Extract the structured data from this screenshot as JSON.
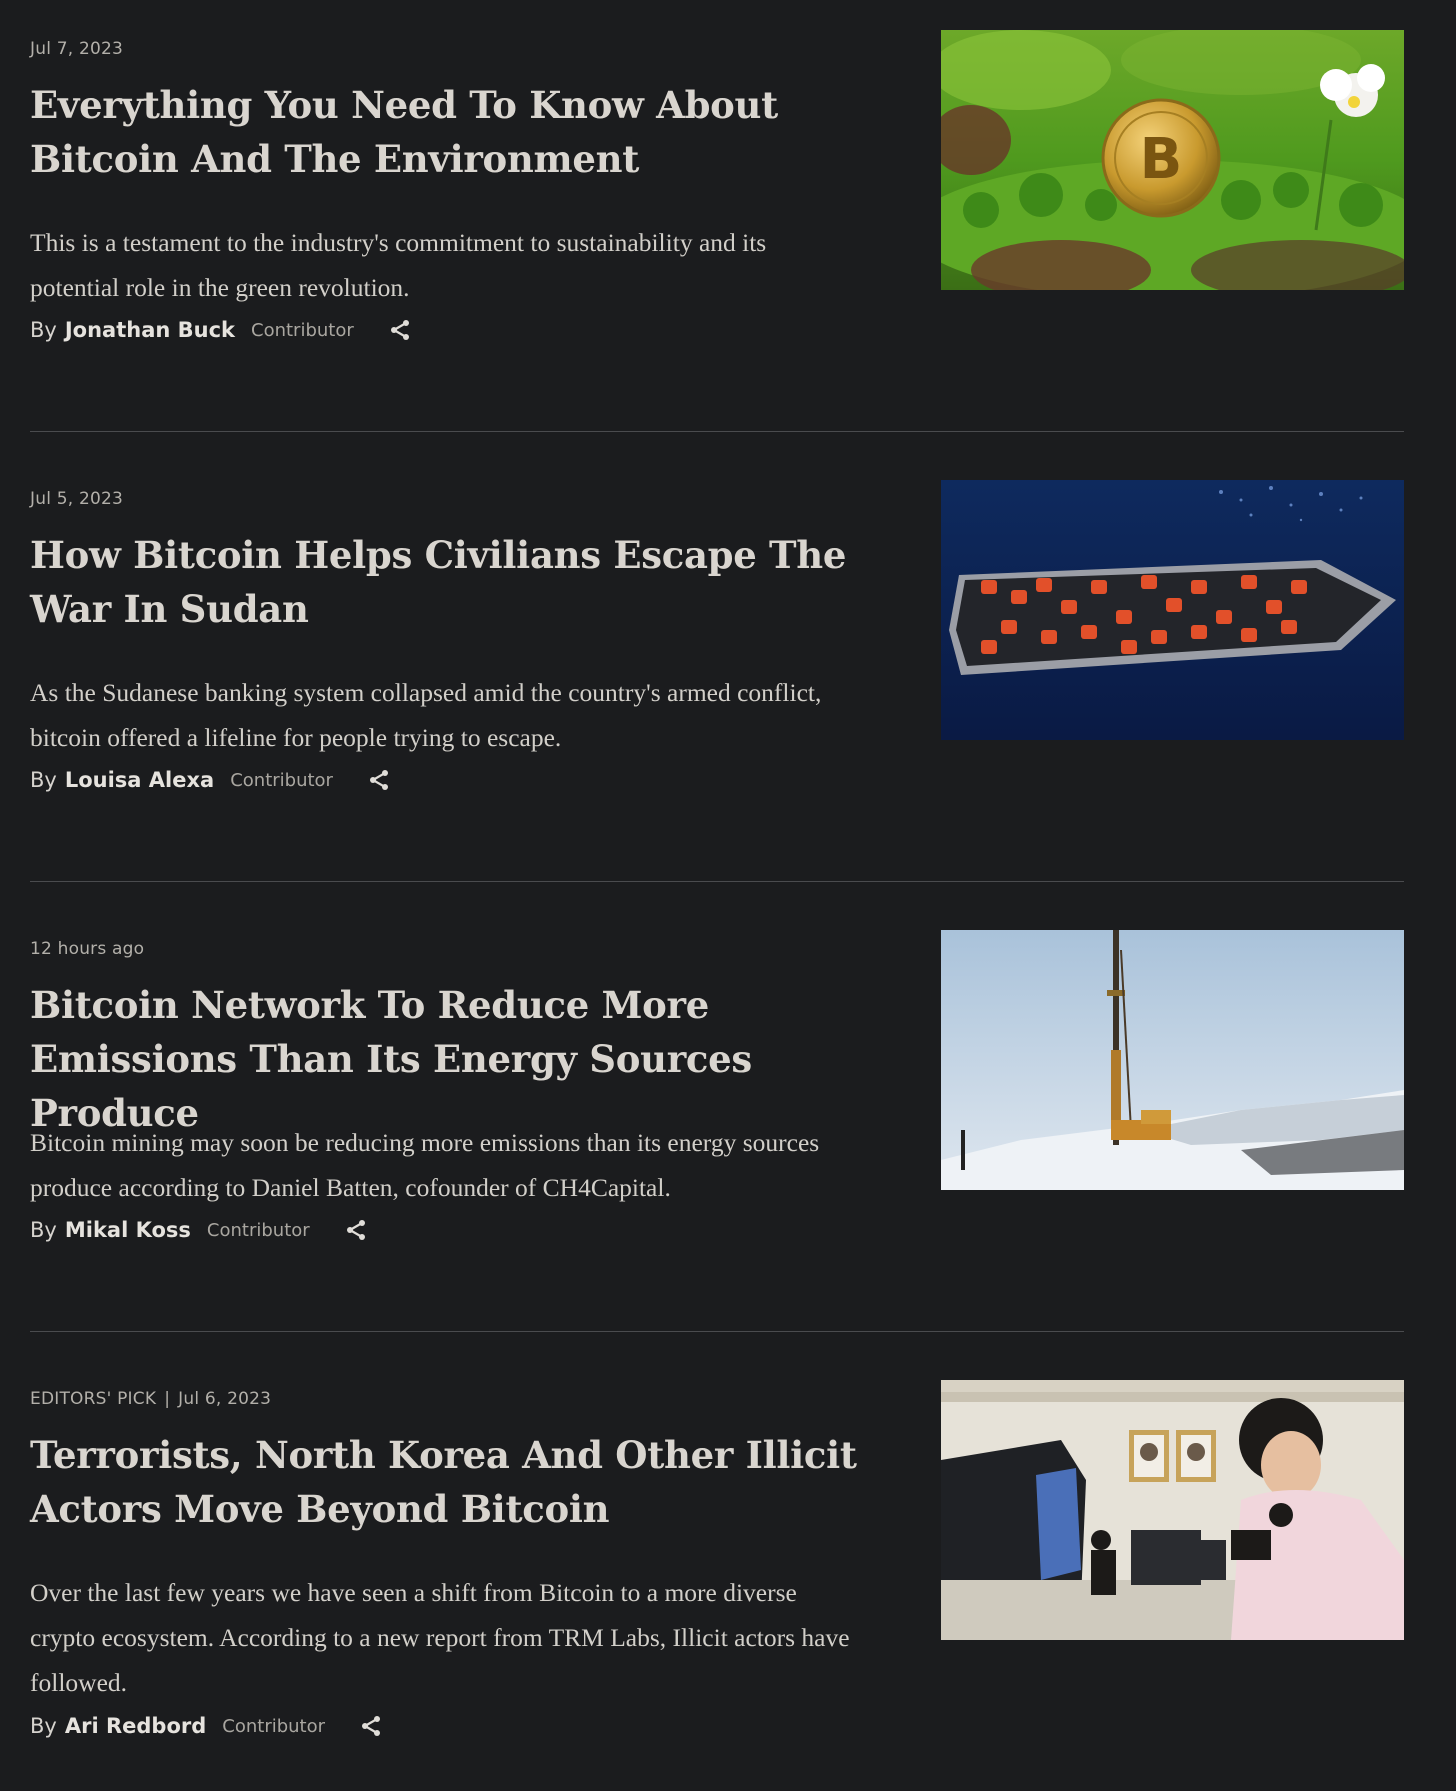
{
  "articles": [
    {
      "meta": "Jul 7, 2023",
      "headline": "Everything You Need To Know About Bitcoin And The Environment",
      "summary": "This is a testament to the industry's commitment to sustainability and its potential role in the green revolution.",
      "by_label": "By",
      "author": "Jonathan Buck",
      "role": "Contributor",
      "image_icon": "bitcoin-coin-in-grass-photo"
    },
    {
      "meta": "Jul 5, 2023",
      "headline": "How Bitcoin Helps Civilians Escape The War In Sudan",
      "summary": "As the Sudanese banking system collapsed amid the country's armed conflict, bitcoin offered a lifeline for people trying to escape.",
      "by_label": "By",
      "author": "Louisa Alexa",
      "role": "Contributor",
      "image_icon": "refugee-boat-photo"
    },
    {
      "meta": "12 hours ago",
      "headline": "Bitcoin Network To Reduce More Emissions Than Its Energy Sources Produce",
      "summary": "Bitcoin mining may soon be reducing more emissions than its energy sources produce according to Daniel Batten, cofounder of CH4Capital.",
      "by_label": "By",
      "author": "Mikal Koss",
      "role": "Contributor",
      "image_icon": "drilling-rig-snow-photo"
    },
    {
      "tag": "EDITORS' PICK",
      "separator": "|",
      "meta": "Jul 6, 2023",
      "headline": "Terrorists, North Korea And Other Illicit Actors Move Beyond Bitcoin",
      "summary": "Over the last few years we have seen a shift from Bitcoin to a more diverse crypto ecosystem. According to a new report from TRM Labs, Illicit actors have followed.",
      "by_label": "By",
      "author": "Ari Redbord",
      "role": "Contributor",
      "image_icon": "computer-lab-photo"
    }
  ],
  "icons": {
    "share": "share-icon"
  },
  "colors": {
    "background": "#1b1c1e",
    "headline": "#d9d5cf",
    "divider": "#4a4b4e"
  }
}
